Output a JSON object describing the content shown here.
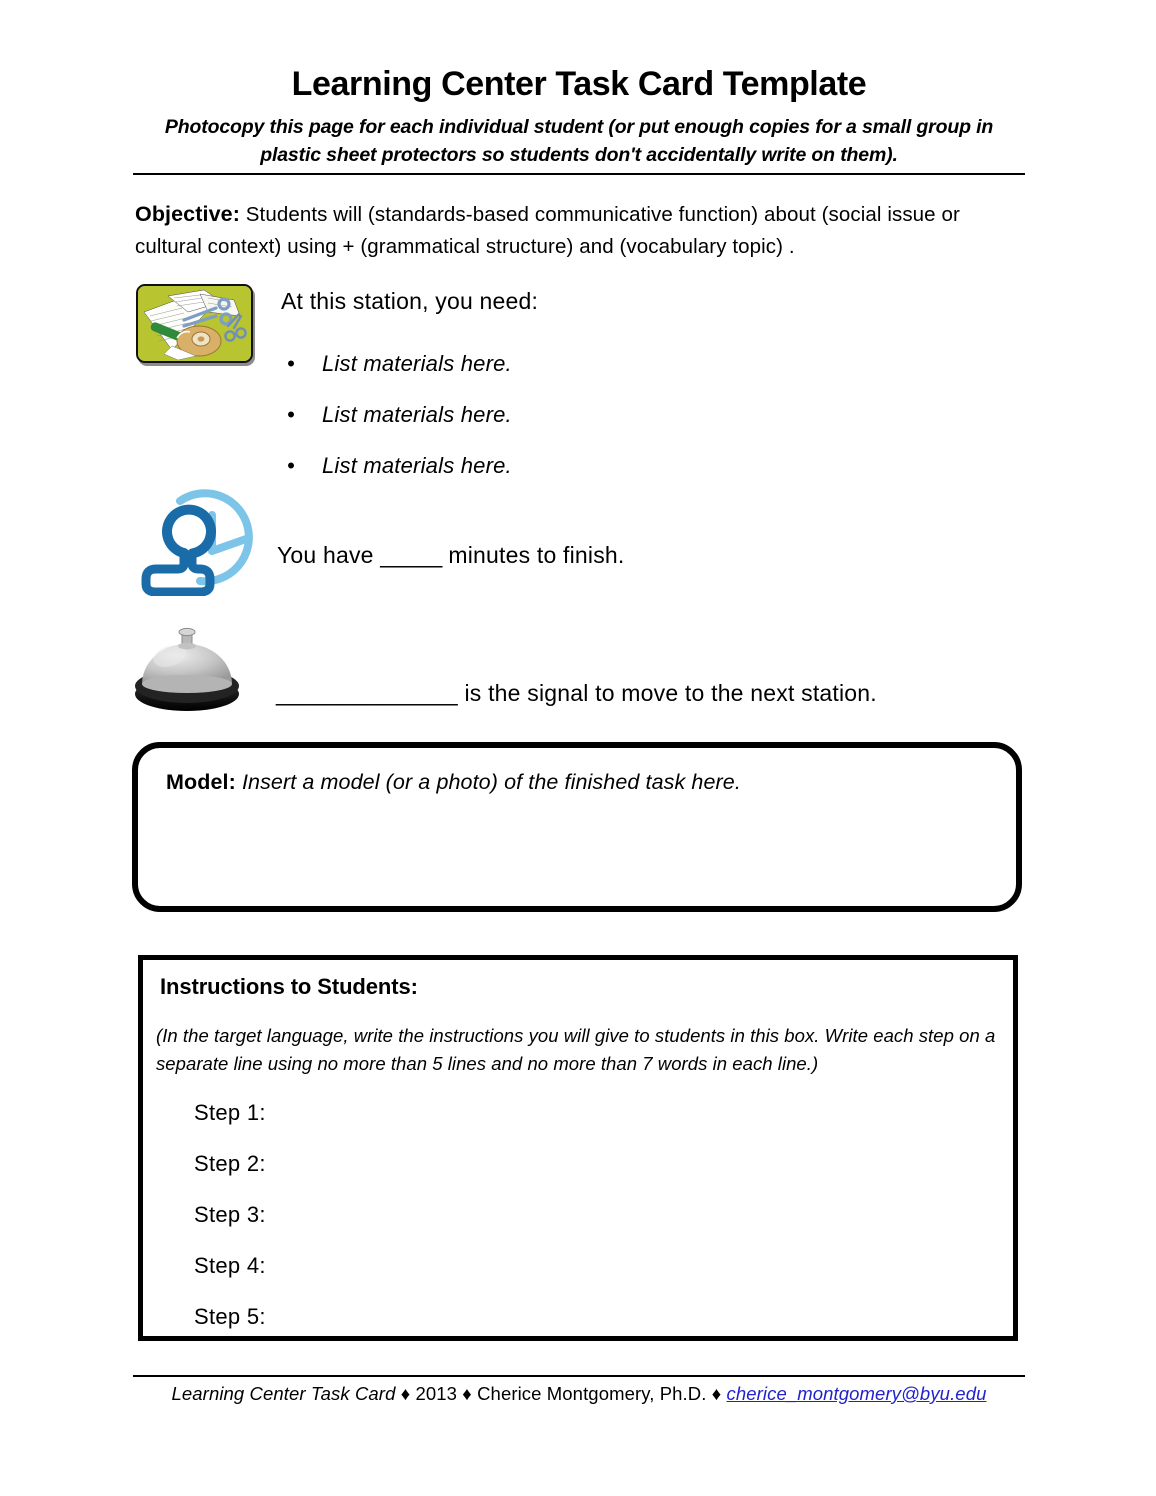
{
  "header": {
    "title": "Learning Center Task Card Template",
    "subtitle": "Photocopy this page for each individual student (or put enough copies for a small group in plastic sheet protectors so students don't accidentally write on them)."
  },
  "objective": {
    "label": "Objective:",
    "text": "Students will   (standards-based communicative function)   about   (social issue or cultural context)   using +   (grammatical structure)   and   (vocabulary topic)  ."
  },
  "materials": {
    "lead": "At this station, you need:",
    "bullet_glyph": "•",
    "items": [
      "List materials here.",
      "List materials here.",
      "List materials here."
    ]
  },
  "timer": {
    "text_before": "You have ",
    "blank": "_____",
    "text_after": " minutes to finish."
  },
  "bell": {
    "blank": "______________",
    "text_after": " is the signal to move to the next station."
  },
  "model": {
    "label": "Model:",
    "text": "Insert a model (or a photo) of the finished task here."
  },
  "instructions": {
    "title": "Instructions to Students:",
    "note": "(In the target language, write the instructions you will give to students in this box.  Write each step on a separate line using no more than 5 lines and no more than 7 words in each line.)",
    "steps": [
      "Step 1:",
      "Step 2:",
      "Step 3:",
      "Step 4:",
      "Step 5:"
    ]
  },
  "footer": {
    "doc_name": "Learning Center Task Card",
    "sep": " ♦ ",
    "year": "2013",
    "author": "Cherice Montgomery, Ph.D.",
    "email": "cherice_montgomery@byu.edu"
  },
  "colors": {
    "clipart_background": "#b8c430",
    "clipart_marker": "#2f8a3c",
    "clipart_scissors": "#7f9ec4",
    "clipart_tape": "#d8b068",
    "timer_person": "#1a6ca8",
    "timer_clock": "#7cc4e8",
    "bell_dome": "#b9b9b9",
    "bell_base": "#1d1d1d",
    "link": "#2222cc"
  }
}
